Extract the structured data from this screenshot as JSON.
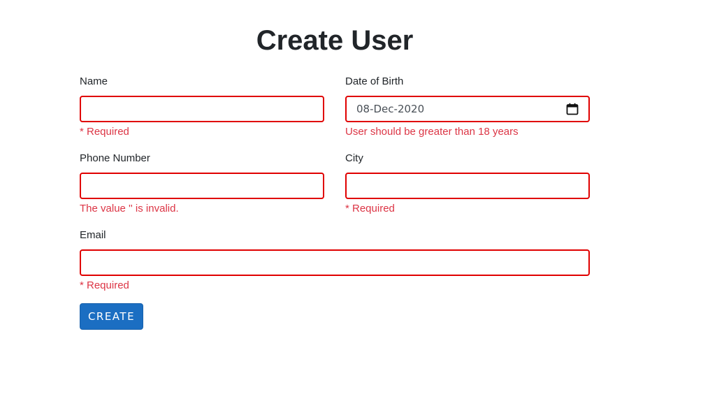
{
  "title": "Create User",
  "fields": {
    "name": {
      "label": "Name",
      "value": "",
      "error": "* Required"
    },
    "dob": {
      "label": "Date of Birth",
      "value": "08-Dec-2020",
      "error": "User should be greater than 18 years",
      "icon": "calendar-icon"
    },
    "phone": {
      "label": "Phone Number",
      "value": "",
      "error": "The value '' is invalid."
    },
    "city": {
      "label": "City",
      "value": "",
      "error": "* Required"
    },
    "email": {
      "label": "Email",
      "value": "",
      "error": "* Required"
    }
  },
  "create_button": {
    "label": "CREATE"
  },
  "colors": {
    "error": "#dc3545",
    "invalid_border": "#e00000",
    "primary": "#1b6ec2"
  }
}
